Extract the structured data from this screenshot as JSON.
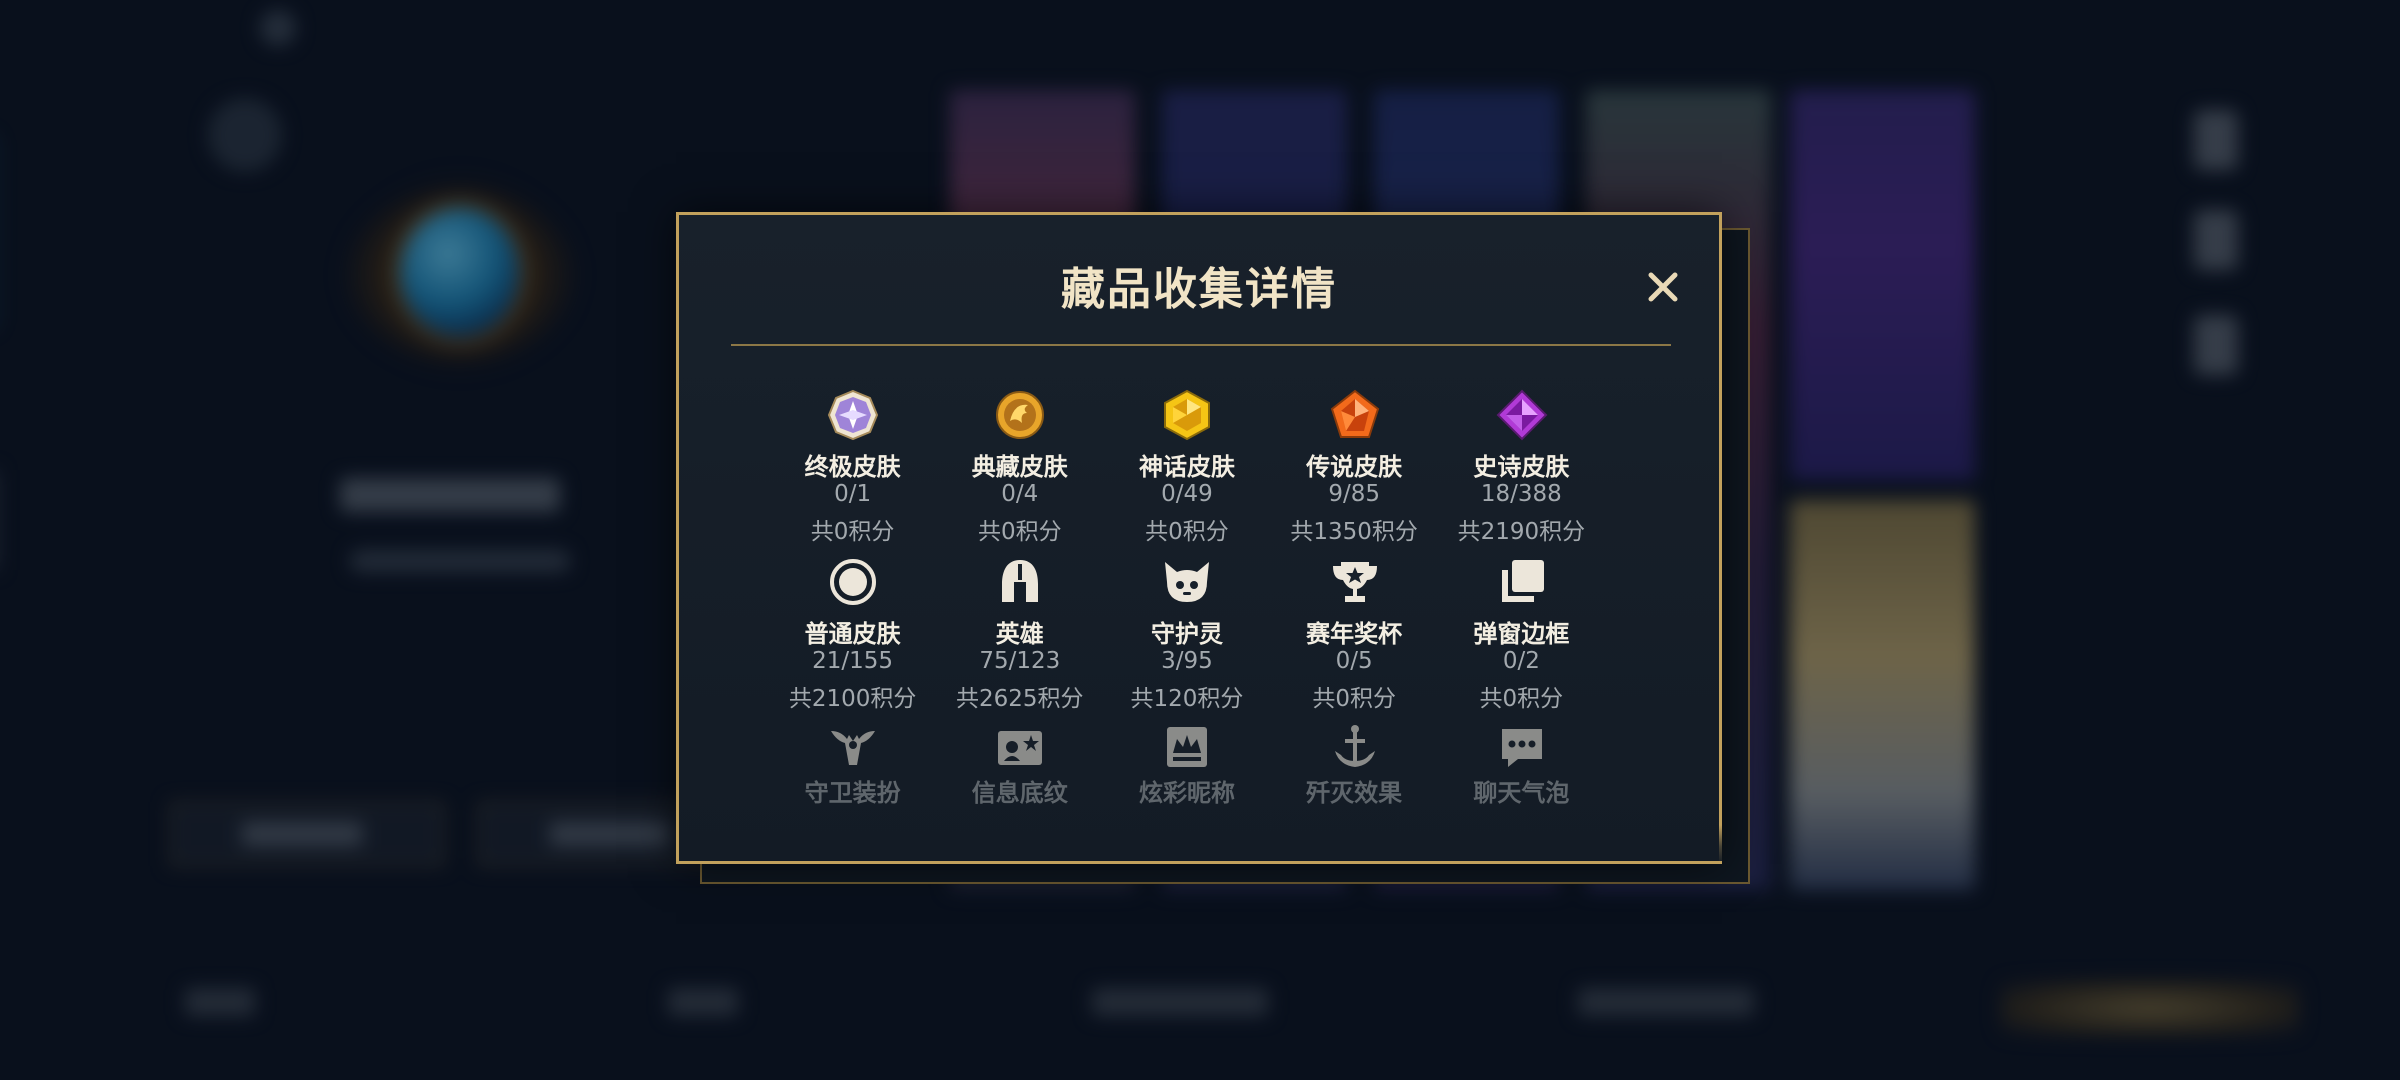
{
  "modal": {
    "title": "藏品收集详情",
    "close_label": "✕"
  },
  "categories": [
    {
      "name": "终极皮肤",
      "count": "0/1",
      "points": "共0积分",
      "icon": "ultimate-skin-icon",
      "color": "#b89cf0"
    },
    {
      "name": "典藏皮肤",
      "count": "0/4",
      "points": "共0积分",
      "icon": "prestige-skin-icon",
      "color": "#e0a22a"
    },
    {
      "name": "神话皮肤",
      "count": "0/49",
      "points": "共0积分",
      "icon": "mythic-skin-icon",
      "color": "#f2c318"
    },
    {
      "name": "传说皮肤",
      "count": "9/85",
      "points": "共1350积分",
      "icon": "legendary-skin-icon",
      "color": "#f06a1a"
    },
    {
      "name": "史诗皮肤",
      "count": "18/388",
      "points": "共2190积分",
      "icon": "epic-skin-icon",
      "color": "#b438d8"
    },
    {
      "name": "普通皮肤",
      "count": "21/155",
      "points": "共2100积分",
      "icon": "common-skin-icon",
      "color": "#e8e2d6"
    },
    {
      "name": "英雄",
      "count": "75/123",
      "points": "共2625积分",
      "icon": "champion-helmet-icon",
      "color": "#e8e2d6"
    },
    {
      "name": "守护灵",
      "count": "3/95",
      "points": "共120积分",
      "icon": "guardian-icon",
      "color": "#e8e2d6"
    },
    {
      "name": "赛年奖杯",
      "count": "0/5",
      "points": "共0积分",
      "icon": "trophy-icon",
      "color": "#e8e2d6"
    },
    {
      "name": "弹窗边框",
      "count": "0/2",
      "points": "共0积分",
      "icon": "popup-frame-icon",
      "color": "#e8e2d6"
    }
  ],
  "faded_categories": [
    {
      "name": "守卫装扮",
      "icon": "ward-skin-icon"
    },
    {
      "name": "信息底纹",
      "icon": "profile-banner-icon"
    },
    {
      "name": "炫彩昵称",
      "icon": "colorful-nickname-icon"
    },
    {
      "name": "歼灭效果",
      "icon": "elimination-effect-icon"
    },
    {
      "name": "聊天气泡",
      "icon": "chat-bubble-icon"
    }
  ],
  "colors": {
    "accent_gold": "#c2a15c",
    "title_text": "#f1e4c6",
    "background": "#0b1422"
  }
}
